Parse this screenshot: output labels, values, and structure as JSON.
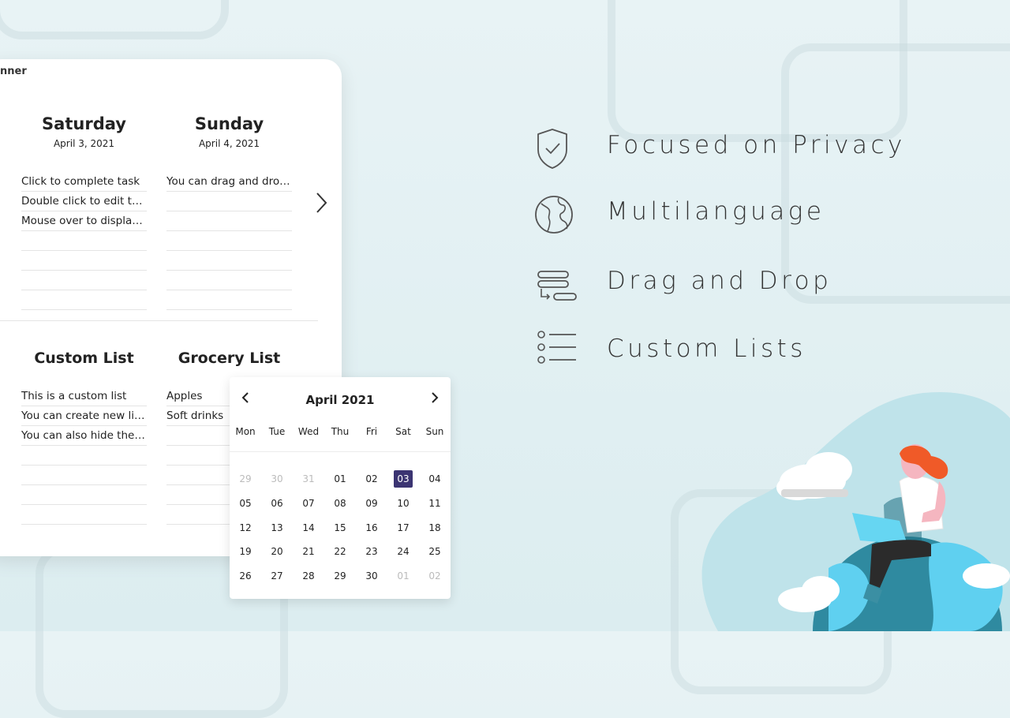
{
  "planner": {
    "app_title": "nner",
    "days": [
      {
        "name": "Saturday",
        "date": "April 3, 2021",
        "tasks": [
          "Click to complete task",
          "Double click to edit task",
          "Mouse over to display…",
          "",
          "",
          "",
          ""
        ]
      },
      {
        "name": "Sunday",
        "date": "April 4, 2021",
        "tasks": [
          "You can drag and dro…",
          "",
          "",
          "",
          "",
          "",
          ""
        ]
      }
    ],
    "lists": [
      {
        "name": "Custom List",
        "items": [
          "This is a custom list",
          "You can create new lis…",
          "You can also hide the…",
          "",
          "",
          "",
          ""
        ]
      },
      {
        "name": "Grocery List",
        "items": [
          "Apples",
          "Soft drinks",
          "",
          "",
          "",
          "",
          ""
        ]
      }
    ]
  },
  "calendar": {
    "title": "April 2021",
    "weekdays": [
      "Mon",
      "Tue",
      "Wed",
      "Thu",
      "Fri",
      "Sat",
      "Sun"
    ],
    "weeks": [
      [
        "29",
        "30",
        "31",
        "01",
        "02",
        "03",
        "04"
      ],
      [
        "05",
        "06",
        "07",
        "08",
        "09",
        "10",
        "11"
      ],
      [
        "12",
        "13",
        "14",
        "15",
        "16",
        "17",
        "18"
      ],
      [
        "19",
        "20",
        "21",
        "22",
        "23",
        "24",
        "25"
      ],
      [
        "26",
        "27",
        "28",
        "29",
        "30",
        "01",
        "02"
      ]
    ],
    "selected": "03"
  },
  "features": [
    {
      "label": "Focused on Privacy",
      "icon": "shield-check-icon"
    },
    {
      "label": "Multilanguage",
      "icon": "globe-icon"
    },
    {
      "label": "Drag and Drop",
      "icon": "drag-drop-icon"
    },
    {
      "label": "Custom Lists",
      "icon": "list-icon"
    }
  ],
  "colors": {
    "selected_day": "#3b3472",
    "background": "#e8f3f5",
    "illustration_blob": "#bfe3ea",
    "globe": "#2f8aa0",
    "hair": "#f05a28"
  }
}
